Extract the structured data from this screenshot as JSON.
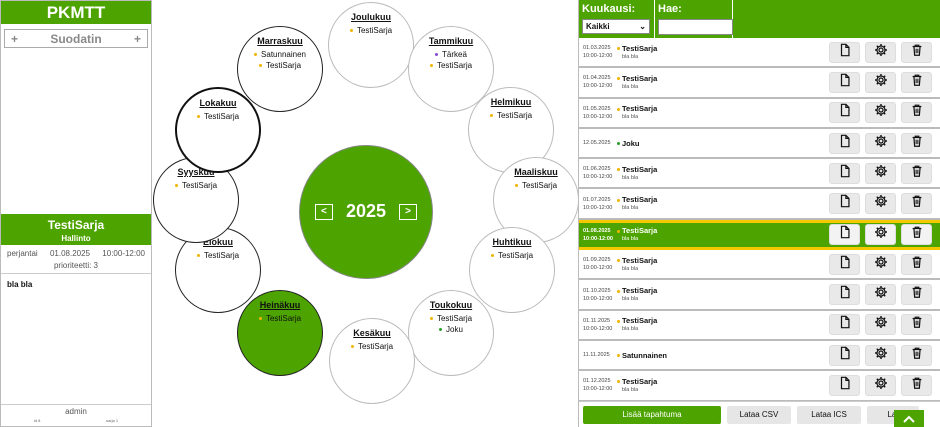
{
  "app": {
    "title": "PKMTT"
  },
  "filter": {
    "label": "Suodatin",
    "left_icon": "+",
    "right_icon": "+"
  },
  "detail": {
    "title": "TestiSarja",
    "category": "Hallinto",
    "weekday": "perjantai",
    "date": "01.08.2025",
    "time": "10:00-12:00",
    "priority": "prioriteetti: 3",
    "description": "bla bla"
  },
  "footer": {
    "user": "admin",
    "meta_left": "id 8",
    "meta_right": "sarja 1"
  },
  "year": {
    "value": "2025",
    "prev": "<",
    "next": ">"
  },
  "months": [
    {
      "name": "Joulukuu",
      "items": [
        {
          "text": "TestiSarja",
          "color": "#f0b400"
        }
      ]
    },
    {
      "name": "Tammikuu",
      "items": [
        {
          "text": "Tärkeä",
          "color": "#8a4bd1"
        },
        {
          "text": "TestiSarja",
          "color": "#f0b400"
        }
      ]
    },
    {
      "name": "Helmikuu",
      "items": [
        {
          "text": "TestiSarja",
          "color": "#f0b400"
        }
      ]
    },
    {
      "name": "Maaliskuu",
      "items": [
        {
          "text": "TestiSarja",
          "color": "#f0b400"
        }
      ]
    },
    {
      "name": "Huhtikuu",
      "items": [
        {
          "text": "TestiSarja",
          "color": "#f0b400"
        }
      ]
    },
    {
      "name": "Toukokuu",
      "items": [
        {
          "text": "TestiSarja",
          "color": "#f0b400"
        },
        {
          "text": "Joku",
          "color": "#2aa02a"
        }
      ]
    },
    {
      "name": "Kesäkuu",
      "items": [
        {
          "text": "TestiSarja",
          "color": "#f0b400"
        }
      ]
    },
    {
      "name": "Heinäkuu",
      "items": [
        {
          "text": "TestiSarja",
          "color": "#f0b400"
        }
      ]
    },
    {
      "name": "Elokuu",
      "items": [
        {
          "text": "TestiSarja",
          "color": "#f0b400"
        }
      ]
    },
    {
      "name": "Syyskuu",
      "items": [
        {
          "text": "TestiSarja",
          "color": "#f0b400"
        }
      ]
    },
    {
      "name": "Lokakuu",
      "items": [
        {
          "text": "TestiSarja",
          "color": "#f0b400"
        }
      ]
    },
    {
      "name": "Marraskuu",
      "items": [
        {
          "text": "Satunnainen",
          "color": "#f0b400"
        },
        {
          "text": "TestiSarja",
          "color": "#f0b400"
        }
      ]
    }
  ],
  "right": {
    "month_label": "Kuukausi:",
    "month_value": "Kaikki",
    "search_label": "Hae:",
    "search_value": "",
    "events": [
      {
        "date": "01.03.2025",
        "time": "10:00-12:00",
        "title": "TestiSarja",
        "desc": "bla bla",
        "color": "#f0b400",
        "selected": false
      },
      {
        "date": "01.04.2025",
        "time": "10:00-12:00",
        "title": "TestiSarja",
        "desc": "bla bla",
        "color": "#f0b400",
        "selected": false
      },
      {
        "date": "01.05.2025",
        "time": "10:00-12:00",
        "title": "TestiSarja",
        "desc": "bla bla",
        "color": "#f0b400",
        "selected": false
      },
      {
        "date": "12.05.2025",
        "time": "",
        "title": "Joku",
        "desc": "",
        "color": "#2aa02a",
        "selected": false
      },
      {
        "date": "01.06.2025",
        "time": "10:00-12:00",
        "title": "TestiSarja",
        "desc": "bla bla",
        "color": "#f0b400",
        "selected": false
      },
      {
        "date": "01.07.2025",
        "time": "10:00-12:00",
        "title": "TestiSarja",
        "desc": "bla bla",
        "color": "#f0b400",
        "selected": false
      },
      {
        "date": "01.08.2025",
        "time": "10:00-12:00",
        "title": "TestiSarja",
        "desc": "bla bla",
        "color": "#f0b400",
        "selected": true
      },
      {
        "date": "01.09.2025",
        "time": "10:00-12:00",
        "title": "TestiSarja",
        "desc": "bla bla",
        "color": "#f0b400",
        "selected": false
      },
      {
        "date": "01.10.2025",
        "time": "10:00-12:00",
        "title": "TestiSarja",
        "desc": "bla bla",
        "color": "#f0b400",
        "selected": false
      },
      {
        "date": "01.11.2025",
        "time": "10:00-12:00",
        "title": "TestiSarja",
        "desc": "bla bla",
        "color": "#f0b400",
        "selected": false
      },
      {
        "date": "11.11.2025",
        "time": "",
        "title": "Satunnainen",
        "desc": "",
        "color": "#f0b400",
        "selected": false
      },
      {
        "date": "01.12.2025",
        "time": "10:00-12:00",
        "title": "TestiSarja",
        "desc": "bla bla",
        "color": "#f0b400",
        "selected": false
      }
    ],
    "buttons": {
      "add": "Lisää tapahtuma",
      "csv": "Lataa CSV",
      "ics": "Lataa ICS",
      "more": "Lat"
    }
  },
  "colors": {
    "accent": "#4da300",
    "highlight": "#f3c800"
  }
}
